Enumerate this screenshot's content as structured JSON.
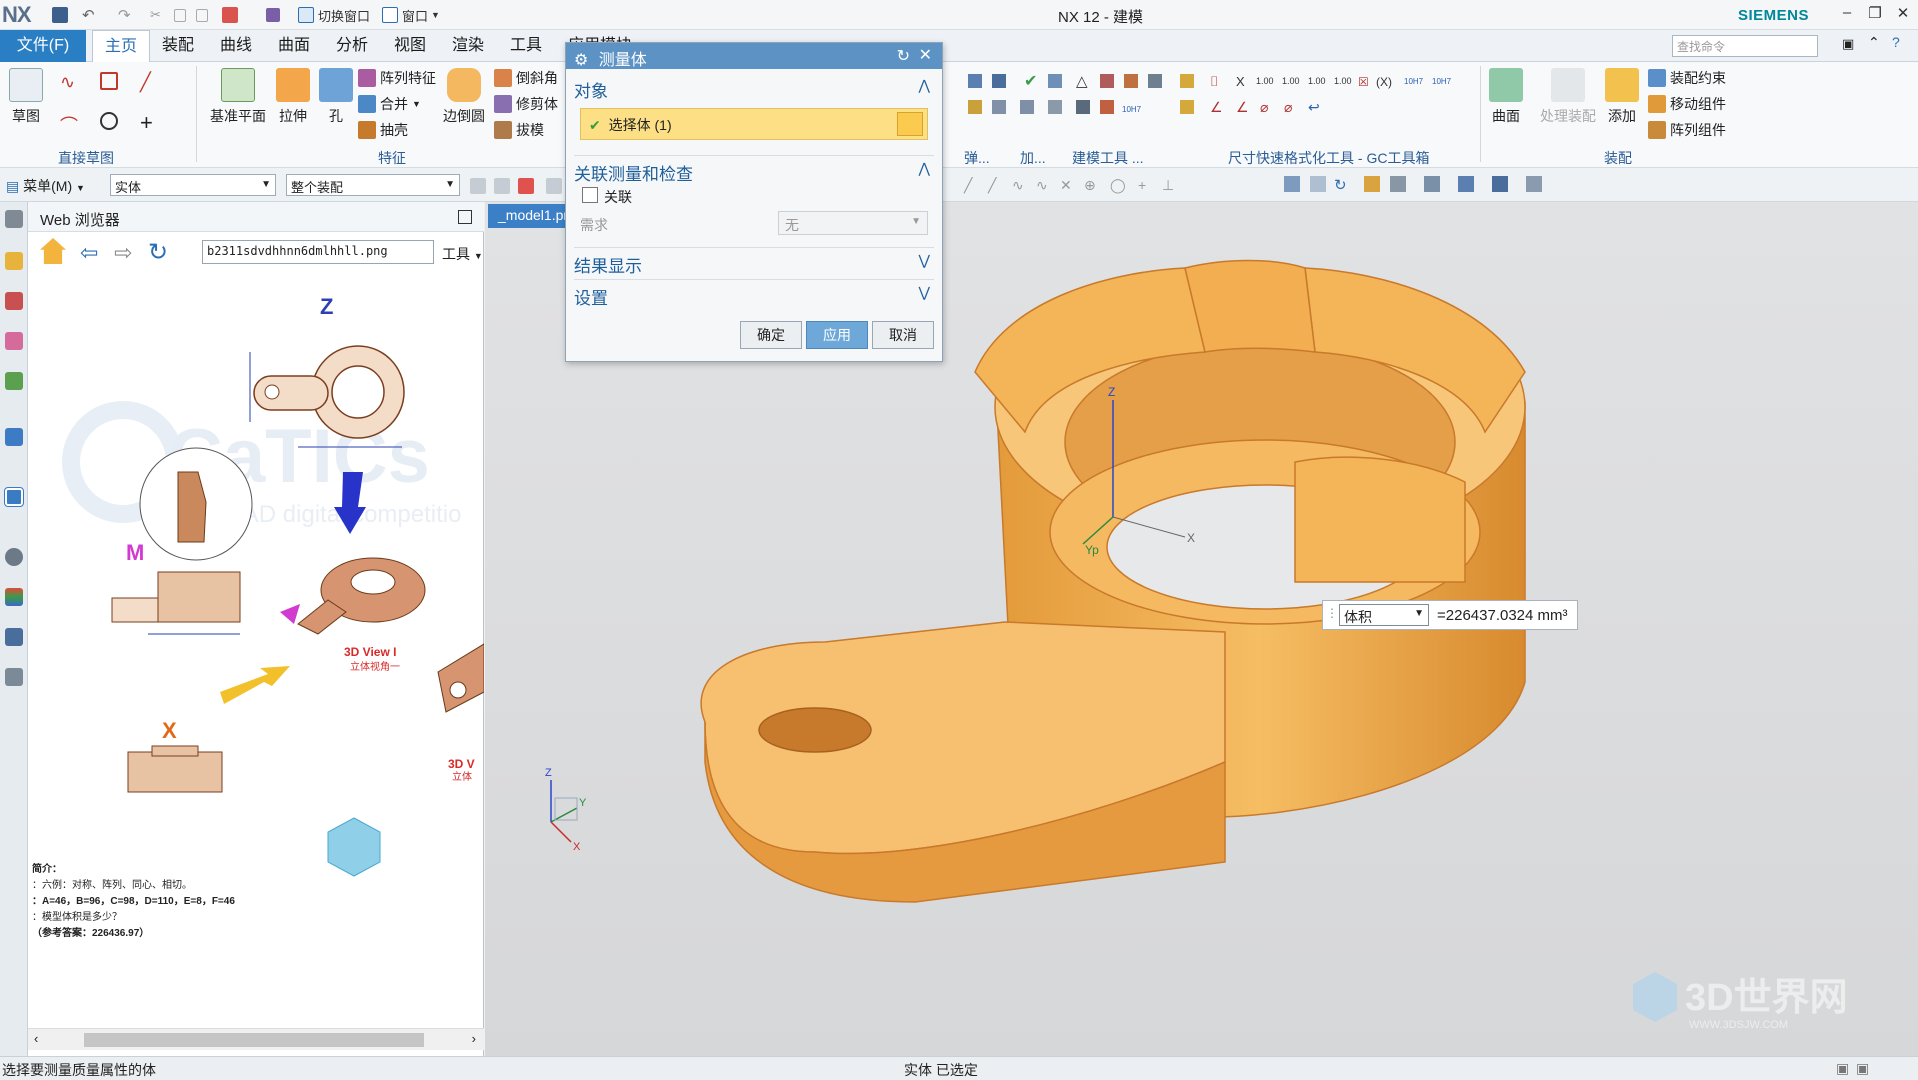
{
  "titlebar": {
    "logo": "NX",
    "switch_window": "切换窗口",
    "window_menu": "窗口",
    "app_title": "NX 12 - 建模",
    "brand": "SIEMENS"
  },
  "tabs": {
    "file": "文件(F)",
    "items": [
      "主页",
      "装配",
      "曲线",
      "曲面",
      "分析",
      "视图",
      "渲染",
      "工具",
      "应用模块"
    ],
    "active": "主页",
    "search_placeholder": "查找命令"
  },
  "ribbon": {
    "sketch": "草图",
    "group_direct_sketch": "直接草图",
    "datum_plane": "基准平面",
    "extrude": "拉伸",
    "hole": "孔",
    "pattern_feature": "阵列特征",
    "unite": "合并",
    "shell": "抽壳",
    "edge_blend": "边倒圆",
    "chamfer": "倒斜角",
    "trim_body": "修剪体",
    "draft": "拔模",
    "group_feature": "特征",
    "spring_label": "弹...",
    "add_label": "加...",
    "modeling_tools": "建模工具 ...",
    "gc_toolbox": "尺寸快速格式化工具 - GC工具箱",
    "surface": "曲面",
    "process_assembly": "处理装配",
    "add": "添加",
    "assembly_constraints": "装配约束",
    "move_component": "移动组件",
    "pattern_component": "阵列组件",
    "group_assembly": "装配"
  },
  "selbar": {
    "menu": "菜单(M)",
    "filter_type": "实体",
    "scope": "整个装配"
  },
  "webpanel": {
    "title": "Web 浏览器",
    "url": "b2311sdvdhhnn6dmlhhll.png",
    "tools": "工具",
    "drawing": {
      "z_label": "Z",
      "m_label": "M",
      "x_label": "X",
      "view_label": "3D View I",
      "view_sub": "立体视角一",
      "view2_label": "3D V",
      "view2_sub": "立体",
      "watermark": "CaTICs",
      "watermark_sub": "3D CAD digital competitio",
      "notes_title": "简介：",
      "notes_line1": "：六例：对称、阵列、同心、相切。",
      "notes_line2": "：A=46，B=96，C=98，D=110，E=8，F=46",
      "notes_line3": "：模型体积是多少？",
      "notes_line4": "（参考答案：226436.97）"
    }
  },
  "gfx": {
    "tab": "_model1.prt",
    "triad_z": "Z",
    "triad_x": "X",
    "triad_y": "Yp",
    "view_z": "Z",
    "view_y": "Y",
    "view_x": "X",
    "watermark": "3D世界网",
    "watermark_url": "WWW.3DSJW.COM"
  },
  "dialog": {
    "title": "测量体",
    "section_object": "对象",
    "select_body": "选择体 (1)",
    "section_assoc": "关联测量和检查",
    "associative": "关联",
    "requirement_label": "需求",
    "requirement_value": "无",
    "section_results": "结果显示",
    "section_settings": "设置",
    "ok": "确定",
    "apply": "应用",
    "cancel": "取消"
  },
  "measure": {
    "type": "体积",
    "value": "=226437.0324 mm³"
  },
  "status": {
    "left": "选择要测量质量属性的体",
    "center": "实体 已选定"
  },
  "colors": {
    "part": "#f4b455",
    "part_dark": "#d98a2a",
    "accent": "#2a7fc4",
    "dialog_title": "#5c92c4"
  }
}
